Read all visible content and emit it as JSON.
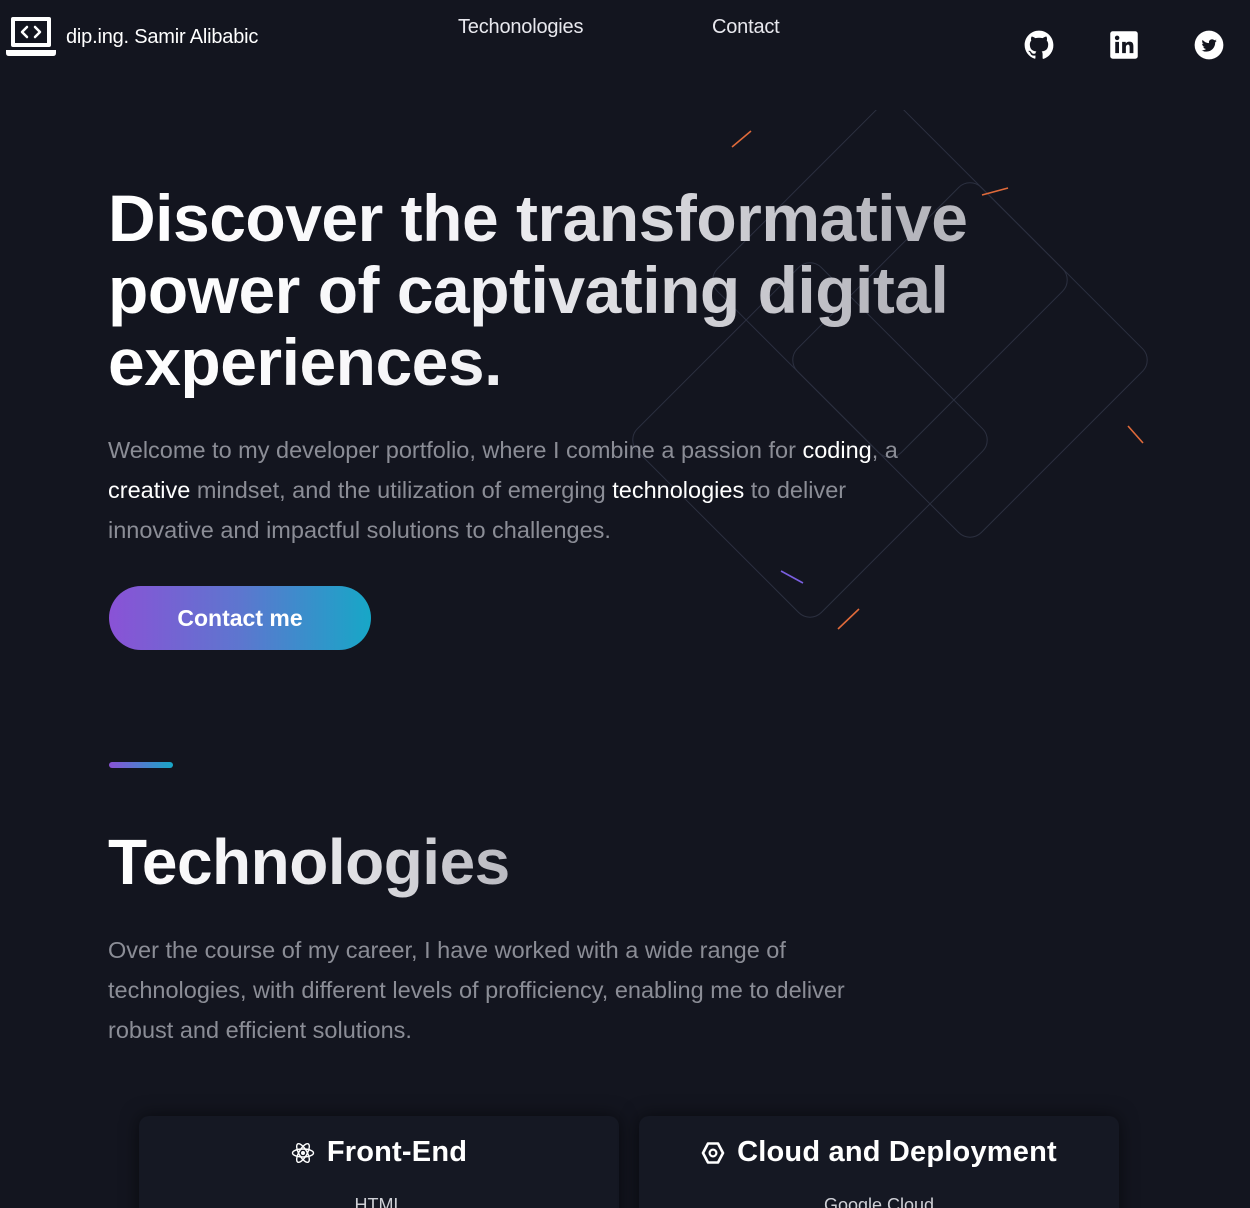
{
  "header": {
    "brand_name": "dip.ing. Samir Alibabic",
    "brand_icon": "laptop-code-icon",
    "nav": [
      {
        "label": "Techonologies"
      },
      {
        "label": "Contact"
      }
    ],
    "social": [
      {
        "icon": "github-icon"
      },
      {
        "icon": "linkedin-icon"
      },
      {
        "icon": "twitter-icon"
      }
    ]
  },
  "hero": {
    "title": "Discover the transformative power of captivating digital experiences.",
    "text_parts": [
      "Welcome to my developer portfolio, where I combine a passion for ",
      "coding",
      ", a ",
      "creative",
      " mindset, and the utilization of emerging ",
      "technologies",
      " to deliver innovative and impactful solutions to challenges."
    ],
    "cta_label": "Contact me"
  },
  "technologies": {
    "title": "Technologies",
    "text": "Over the course of my career, I have worked with a wide range of technologies, with different levels of profficiency, enabling me to deliver robust and efficient solutions.",
    "cards": [
      {
        "title": "Front-End",
        "icon": "react-atom-icon",
        "first_item": "HTML"
      },
      {
        "title": "Cloud and Deployment",
        "icon": "hexagon-cloud-icon",
        "first_item": "Google Cloud"
      }
    ]
  },
  "colors": {
    "background": "#13151f",
    "accent_start": "#8a52d6",
    "accent_end": "#17a7c7",
    "muted_text": "#8b8d96"
  }
}
